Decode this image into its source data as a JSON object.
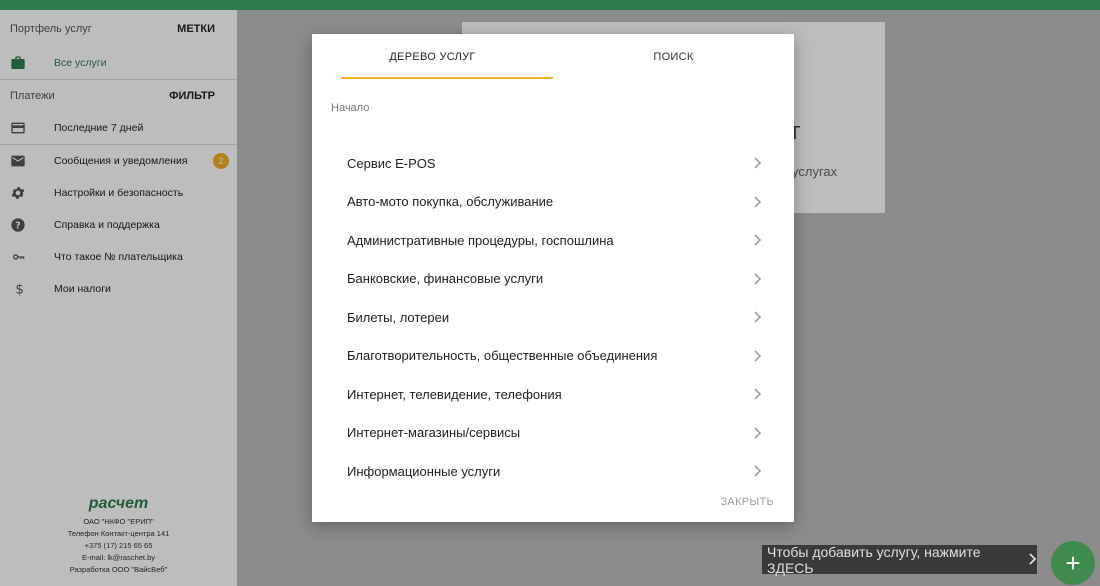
{
  "sidebar": {
    "portfolio_header": "Портфель услуг",
    "labels_link": "МЕТКИ",
    "all_services": "Все услуги",
    "payments_header": "Платежи",
    "filter_link": "ФИЛЬТР",
    "items": [
      {
        "label": "Последние 7 дней",
        "icon": "card-icon"
      },
      {
        "label": "Сообщения и уведомления",
        "icon": "mail-icon",
        "badge": "2"
      },
      {
        "label": "Настройки и безопасность",
        "icon": "gear-icon"
      },
      {
        "label": "Справка и поддержка",
        "icon": "help-icon"
      },
      {
        "label": "Что такое № плательщика",
        "icon": "key-icon"
      },
      {
        "label": "Мои налоги",
        "icon": "dollar-icon"
      }
    ],
    "footer": {
      "logo": "расчет",
      "org": "ОАО \"НКФО \"ЕРИП\"",
      "phone_label": "Телефон Контакт-центра 141",
      "phone": "+375 (17) 215 65 65",
      "email": "E-mail: lk@raschet.by",
      "dev": "Разработка ООО \"ВайсВеб\""
    }
  },
  "background_card": {
    "title_fragment": "г",
    "text_fragment": "услугах"
  },
  "dialog": {
    "tab_tree": "ДЕРЕВО УСЛУГ",
    "tab_search": "ПОИСК",
    "breadcrumb": "Начало",
    "categories": [
      "Сервис E-POS",
      "Авто-мото покупка, обслуживание",
      "Административные процедуры, госпошлина",
      "Банковские, финансовые услуги",
      "Билеты, лотереи",
      "Благотворительность, общественные объединения",
      "Интернет, телевидение, телефония",
      "Интернет-магазины/сервисы",
      "Информационные услуги"
    ],
    "close": "ЗАКРЫТЬ"
  },
  "hint": "Чтобы добавить услугу, нажмите ЗДЕСЬ",
  "fab": "+",
  "colors": {
    "brand_green": "#2e7d4f",
    "accent_yellow": "#f2b01e"
  }
}
